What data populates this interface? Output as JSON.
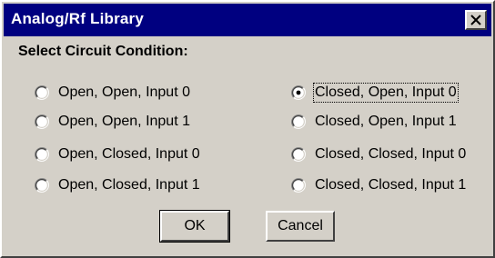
{
  "window": {
    "title": "Analog/Rf Library",
    "close_icon": "close-icon"
  },
  "prompt": "Select Circuit Condition:",
  "options": [
    {
      "label": "Open, Open, Input 0",
      "selected": false
    },
    {
      "label": "Open, Open, Input 1",
      "selected": false
    },
    {
      "label": "Open, Closed, Input 0",
      "selected": false
    },
    {
      "label": "Open, Closed, Input 1",
      "selected": false
    },
    {
      "label": "Closed, Open, Input 0",
      "selected": true
    },
    {
      "label": "Closed, Open, Input 1",
      "selected": false
    },
    {
      "label": "Closed, Closed, Input 0",
      "selected": false
    },
    {
      "label": "Closed, Closed, Input 1",
      "selected": false
    }
  ],
  "buttons": {
    "ok_label": "OK",
    "cancel_label": "Cancel"
  },
  "colors": {
    "titlebar": "#000080",
    "face": "#d4d0c8"
  }
}
